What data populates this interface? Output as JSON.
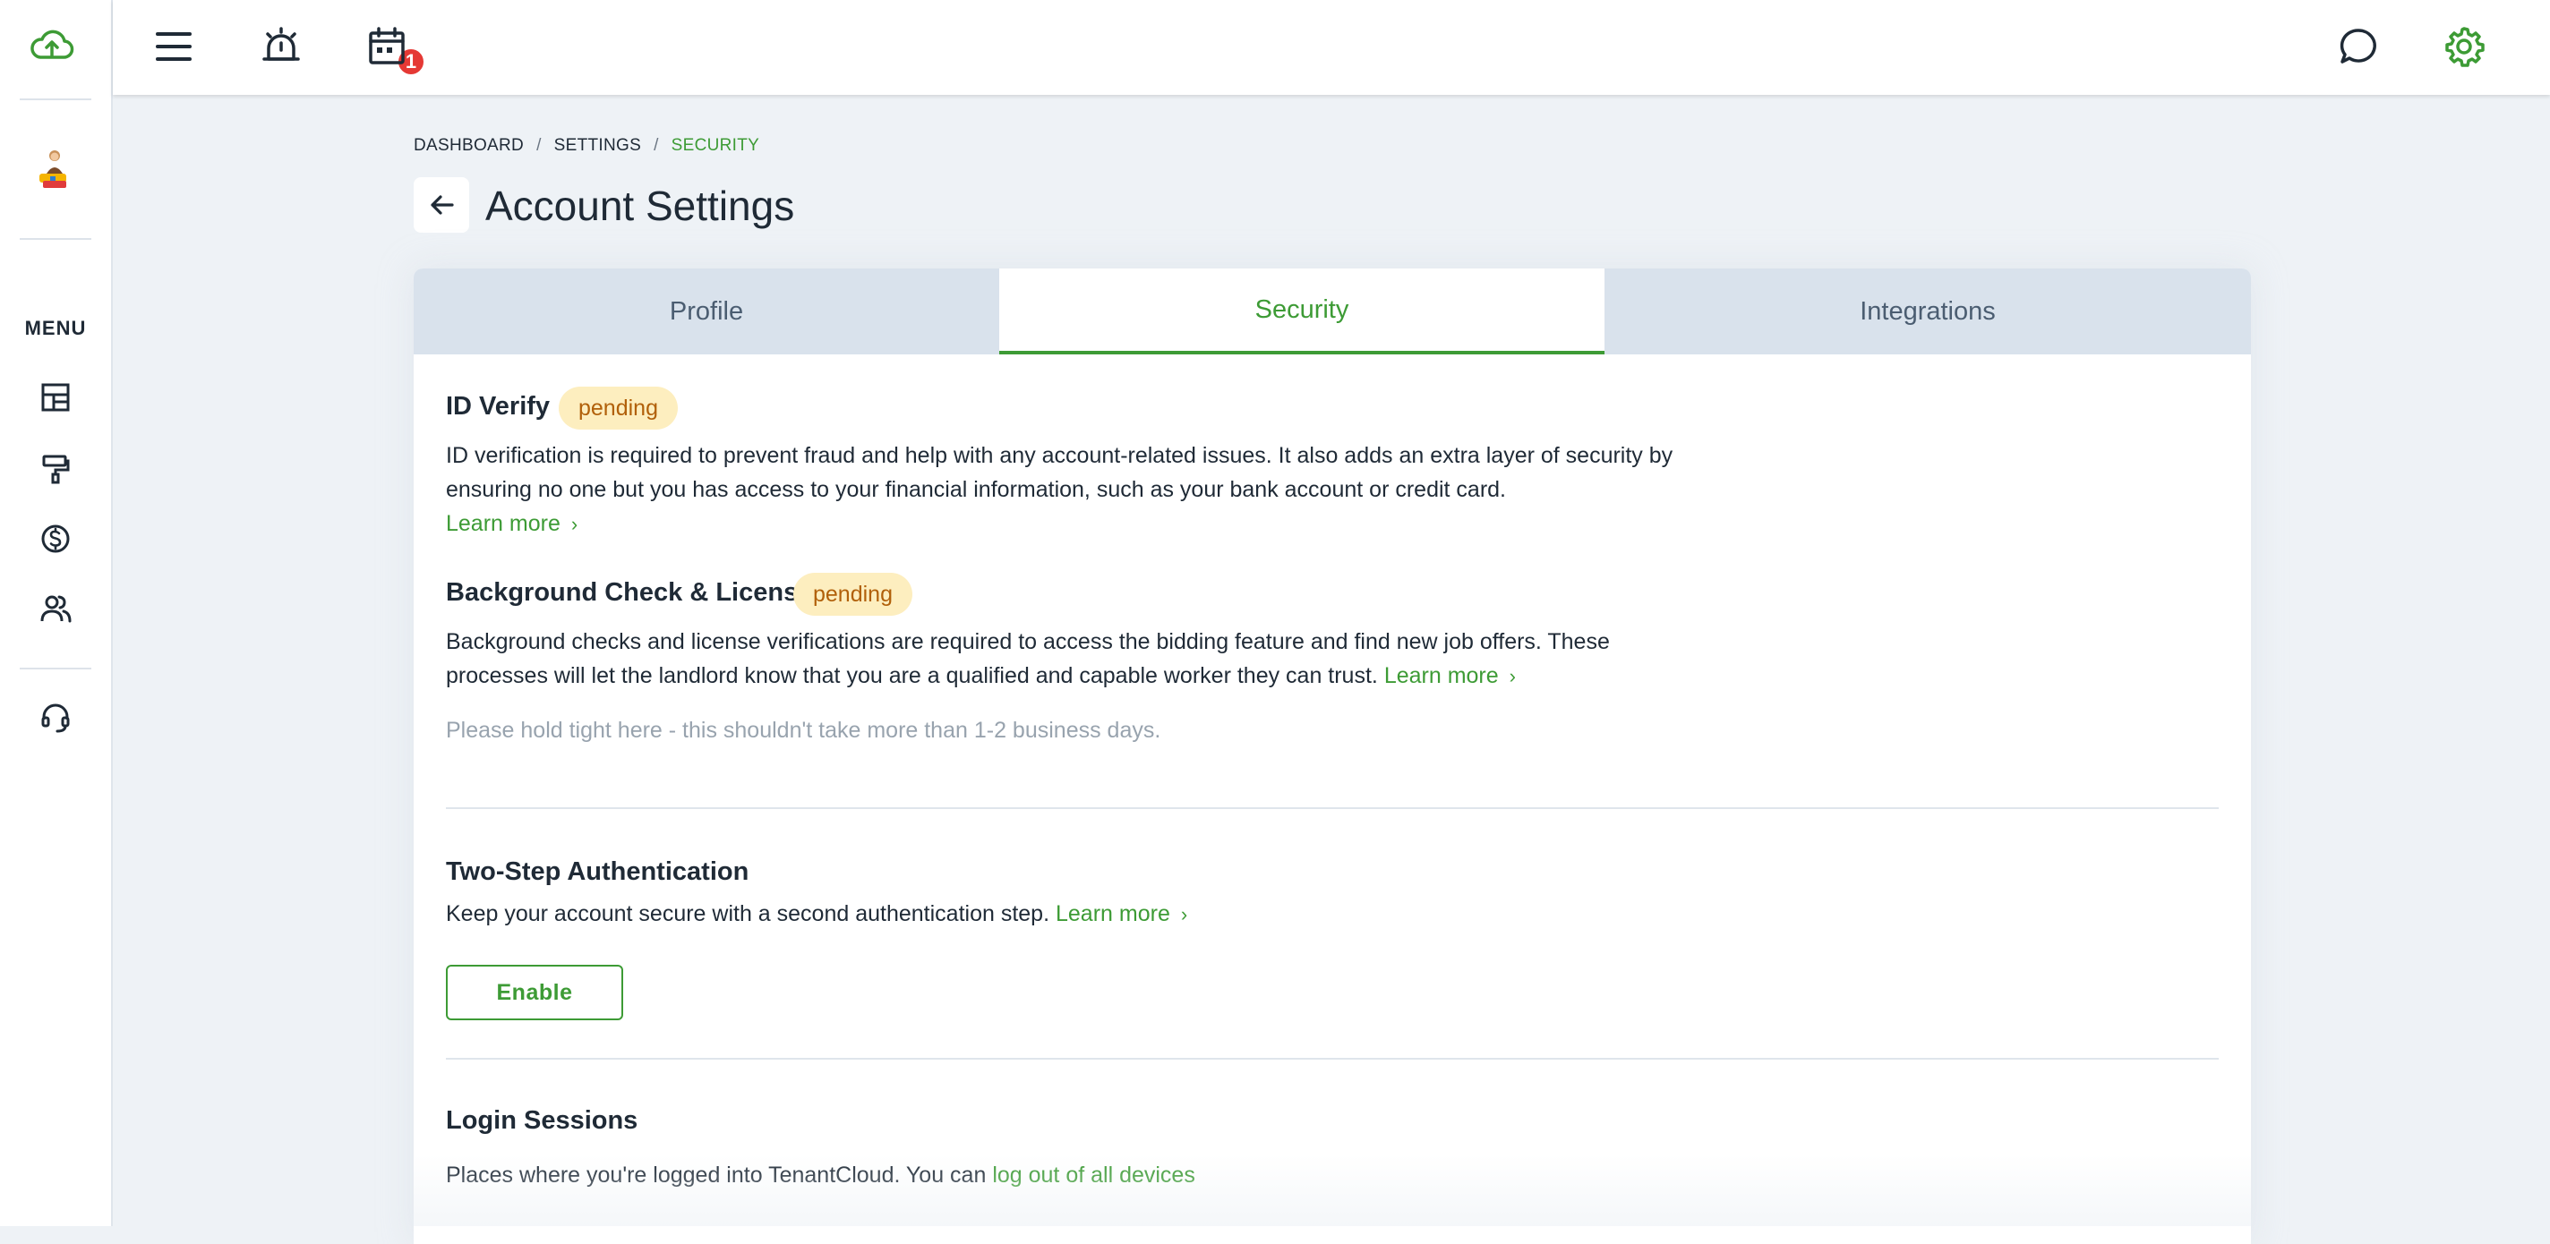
{
  "colors": {
    "accent": "#3d9b35",
    "pending_bg": "#fdeebf",
    "pending_text": "#b1600a",
    "badge": "#e53935"
  },
  "sidebar": {
    "logo_icon": "cloud-upload-icon",
    "menu_label": "MENU",
    "items": [
      {
        "icon": "dashboard-icon"
      },
      {
        "icon": "paint-roller-icon"
      },
      {
        "icon": "dollar-circle-icon"
      },
      {
        "icon": "users-icon"
      },
      {
        "icon": "headset-icon"
      }
    ]
  },
  "topbar": {
    "notification_count": "1",
    "icons": [
      "hamburger-icon",
      "alarm-icon",
      "calendar-icon",
      "chat-icon",
      "gear-icon"
    ]
  },
  "breadcrumb": {
    "items": [
      "DASHBOARD",
      "SETTINGS",
      "SECURITY"
    ],
    "separator": "/"
  },
  "page": {
    "title": "Account Settings"
  },
  "tabs": [
    "Profile",
    "Security",
    "Integrations"
  ],
  "id_verify": {
    "title": "ID Verify",
    "status": "pending",
    "description": "ID verification is required to prevent fraud and help with any account-related issues. It also adds an extra layer of security by ensuring no one but you has access to your financial information, such as your bank account or credit card.",
    "link": "Learn more"
  },
  "background_check": {
    "title": "Background Check & License",
    "status": "pending",
    "description": "Background checks and license verifications are required to access the bidding feature and find new job offers. These processes will let the landlord know that you are a qualified and capable worker they can trust.",
    "link": "Learn more",
    "note": "Please hold tight here - this shouldn't take more than 1-2 business days."
  },
  "two_step": {
    "title": "Two-Step Authentication",
    "description": "Keep your account secure with a second authentication step.",
    "link": "Learn more",
    "button": "Enable"
  },
  "login_sessions": {
    "title": "Login Sessions",
    "description": "Places where you're logged into TenantCloud. You can",
    "link": "log out of all devices"
  }
}
